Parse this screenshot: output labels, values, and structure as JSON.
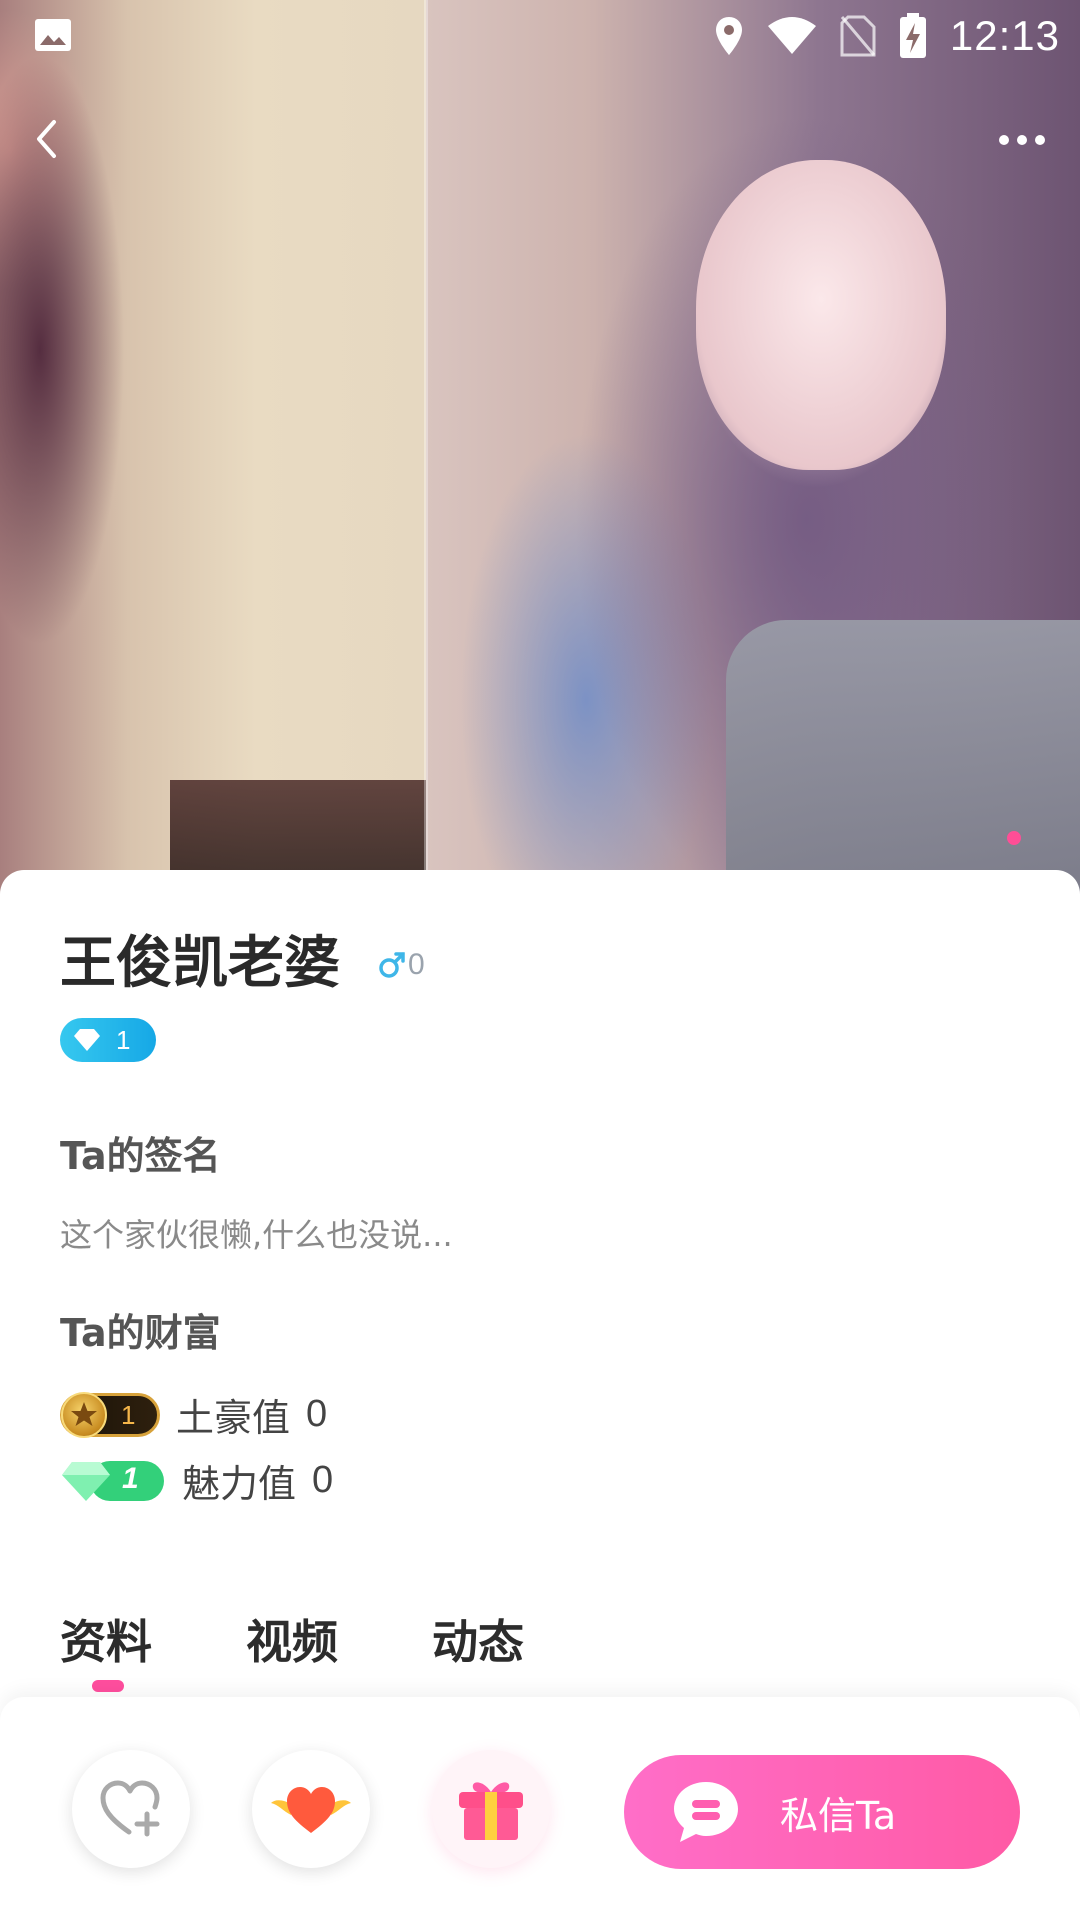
{
  "status_bar": {
    "time": "12:13",
    "icons": [
      "gallery-icon",
      "location-icon",
      "wifi-icon",
      "no-sim-icon",
      "battery-charging-icon"
    ]
  },
  "nav": {
    "back_icon": "chevron-left-icon",
    "more_icon": "more-dots-icon"
  },
  "profile": {
    "name": "王俊凯老婆",
    "gender_icon": "male-icon",
    "age": "0",
    "vip_level": "1"
  },
  "signature": {
    "title": "Ta的签名",
    "text": "这个家伙很懒,什么也没说..."
  },
  "wealth": {
    "title": "Ta的财富",
    "rich": {
      "badge_level": "1",
      "label": "土豪值",
      "value": "0"
    },
    "charm": {
      "badge_level": "1",
      "label": "魅力值",
      "value": "0"
    }
  },
  "tabs": [
    {
      "label": "资料",
      "active": true
    },
    {
      "label": "视频",
      "active": false
    },
    {
      "label": "动态",
      "active": false
    }
  ],
  "actions": {
    "follow_icon": "heart-plus-icon",
    "like_icon": "winged-heart-icon",
    "gift_icon": "gift-icon",
    "message_label": "私信Ta"
  },
  "colors": {
    "accent_pink": "#ff5aa5",
    "vip_blue": "#16a8e6",
    "charm_green": "#3ee08a",
    "gender_blue": "#3fb6e8",
    "rich_gold": "#d7a23b"
  }
}
